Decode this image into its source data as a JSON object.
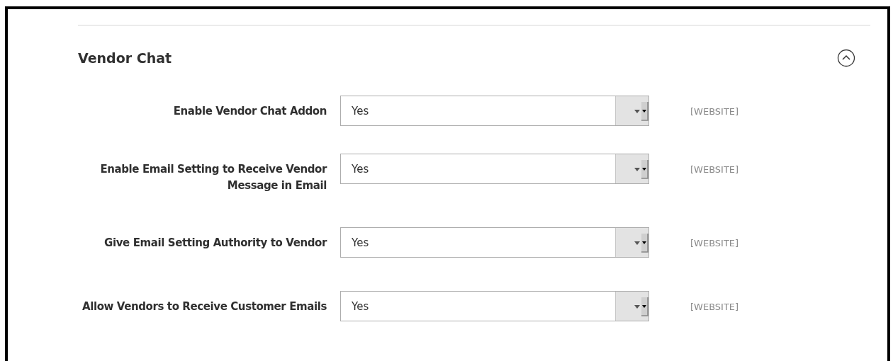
{
  "section": {
    "title": "Vendor Chat",
    "expanded": true
  },
  "fields": [
    {
      "label": "Enable Vendor Chat Addon",
      "value": "Yes",
      "scope": "[WEBSITE]"
    },
    {
      "label": "Enable Email Setting to Receive Vendor Message in Email",
      "value": "Yes",
      "scope": "[WEBSITE]"
    },
    {
      "label": "Give Email Setting Authority to Vendor",
      "value": "Yes",
      "scope": "[WEBSITE]"
    },
    {
      "label": "Allow Vendors to Receive Customer Emails",
      "value": "Yes",
      "scope": "[WEBSITE]"
    }
  ]
}
